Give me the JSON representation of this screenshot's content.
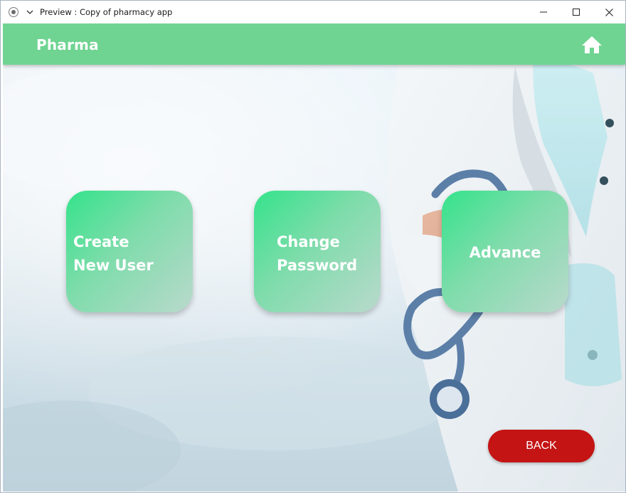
{
  "window": {
    "title": "Preview : Copy of pharmacy app",
    "controls": [
      "minimize",
      "maximize",
      "close"
    ]
  },
  "header": {
    "brand": "Pharma",
    "home_icon": "home-icon",
    "color": "#6fd491"
  },
  "tiles": [
    {
      "id": "create-new-user",
      "lines": [
        "Create",
        "New User"
      ]
    },
    {
      "id": "change-password",
      "lines": [
        "Change",
        "Password"
      ]
    },
    {
      "id": "advance",
      "lines": [
        "Advance"
      ]
    }
  ],
  "back_button": {
    "label": "BACK",
    "color": "#c41414"
  },
  "colors": {
    "tile_gradient_start": "#34e38b",
    "tile_gradient_end": "#b9d9cc"
  }
}
